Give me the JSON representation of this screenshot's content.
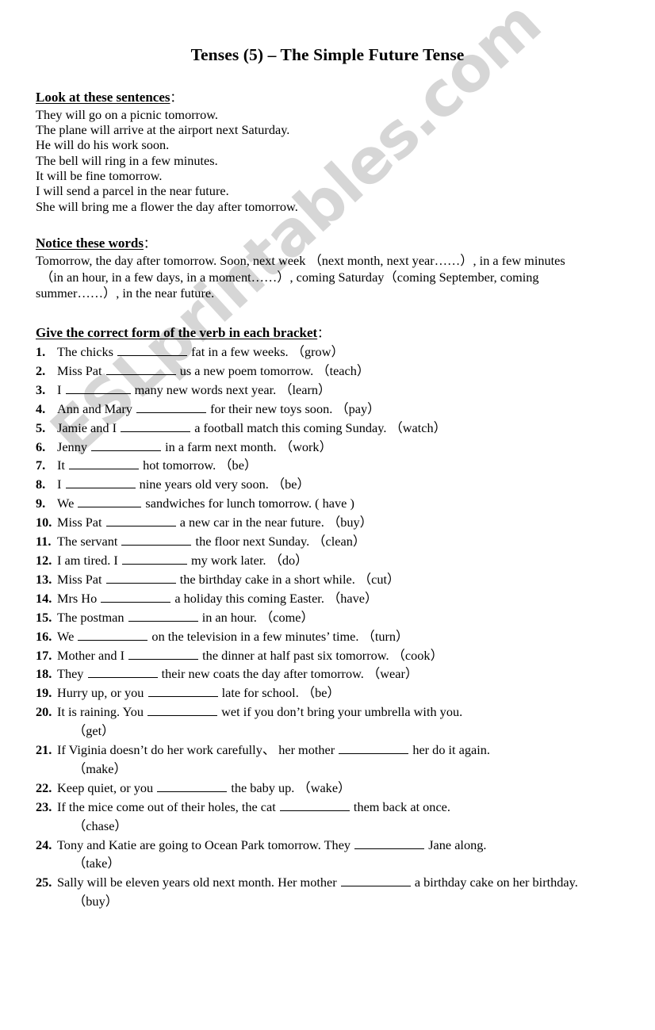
{
  "document": {
    "title": "Tenses (5) – The Simple Future Tense",
    "watermark": "ESLprintables.com",
    "watermark_color": "#d6d6d6",
    "text_color": "#000000",
    "background_color": "#ffffff"
  },
  "section_examples": {
    "heading": "Look at these sentences",
    "heading_colon": "：",
    "sentences": [
      "They will go on a picnic tomorrow.",
      "The plane will arrive at the airport next Saturday.",
      "He will do his work soon.",
      "The bell will ring in a few minutes.",
      "It will be fine tomorrow.",
      "I will send a parcel in the near future.",
      "She will bring me a flower the day after tomorrow."
    ]
  },
  "section_notice": {
    "heading": "Notice these words",
    "heading_colon": "：",
    "line1": "Tomorrow, the day after tomorrow. Soon, next week  （next month, next year……）, in a few minutes",
    "line2": "（in an hour, in a few days, in a moment……）, coming Saturday（coming September, coming",
    "line3": "summer……）, in the near future."
  },
  "section_exercise": {
    "heading": "Give the correct form of the verb in each bracket",
    "heading_colon": "：",
    "items": [
      {
        "number": "1.",
        "before": "The chicks ",
        "blank_width": 88,
        "after": " fat in a few weeks.  ",
        "hint": "（grow）",
        "hint_on_new_line": false,
        "verb": "grow"
      },
      {
        "number": "2.",
        "before": "Miss Pat ",
        "blank_width": 88,
        "after": " us a new poem tomorrow.  ",
        "hint": "（teach）",
        "hint_on_new_line": false,
        "verb": "teach"
      },
      {
        "number": "3.",
        "before": "I ",
        "blank_width": 82,
        "after": " many new words next year.  ",
        "hint": "（learn）",
        "hint_on_new_line": false,
        "verb": "learn"
      },
      {
        "number": "4.",
        "before": "Ann and Mary ",
        "blank_width": 88,
        "after": " for their new toys soon.  ",
        "hint": "（pay）",
        "hint_on_new_line": false,
        "verb": "pay"
      },
      {
        "number": "5.",
        "before": "Jamie and I ",
        "blank_width": 88,
        "after": " a football match this coming Sunday.  ",
        "hint": "（watch）",
        "hint_on_new_line": false,
        "verb": "watch"
      },
      {
        "number": "6.",
        "before": "Jenny ",
        "blank_width": 88,
        "after": " in a farm next month.  ",
        "hint": "（work）",
        "hint_on_new_line": false,
        "verb": "work"
      },
      {
        "number": "7.",
        "before": "It ",
        "blank_width": 88,
        "after": " hot tomorrow.  ",
        "hint": "（be）",
        "hint_on_new_line": false,
        "verb": "be"
      },
      {
        "number": "8.",
        "before": "I ",
        "blank_width": 88,
        "after": " nine years old very soon.  ",
        "hint": "（be）",
        "hint_on_new_line": false,
        "verb": "be"
      },
      {
        "number": "9.",
        "before": "We ",
        "blank_width": 80,
        "after": " sandwiches for lunch tomorrow. ",
        "hint": "( have )",
        "hint_on_new_line": false,
        "verb": "have"
      },
      {
        "number": "10.",
        "before": "Miss Pat ",
        "blank_width": 88,
        "after": " a new car in the near future.  ",
        "hint": "（buy）",
        "hint_on_new_line": false,
        "verb": "buy"
      },
      {
        "number": "11.",
        "before": "The servant ",
        "blank_width": 88,
        "after": " the floor next Sunday.  ",
        "hint": "（clean）",
        "hint_on_new_line": false,
        "verb": "clean"
      },
      {
        "number": "12.",
        "before": "I am tired. I ",
        "blank_width": 82,
        "after": " my work later.  ",
        "hint": "（do）",
        "hint_on_new_line": false,
        "verb": "do"
      },
      {
        "number": "13.",
        "before": "Miss Pat ",
        "blank_width": 88,
        "after": " the birthday cake in a short while.  ",
        "hint": "（cut）",
        "hint_on_new_line": false,
        "verb": "cut"
      },
      {
        "number": "14.",
        "before": "Mrs Ho ",
        "blank_width": 88,
        "after": " a holiday this coming Easter.  ",
        "hint": "（have）",
        "hint_on_new_line": false,
        "verb": "have"
      },
      {
        "number": "15.",
        "before": "The postman ",
        "blank_width": 88,
        "after": " in an hour.  ",
        "hint": "（come）",
        "hint_on_new_line": false,
        "verb": "come"
      },
      {
        "number": "16.",
        "before": "We ",
        "blank_width": 88,
        "after": " on the television in a few minutes’ time.  ",
        "hint": "（turn）",
        "hint_on_new_line": false,
        "verb": "turn"
      },
      {
        "number": "17.",
        "before": "Mother and I ",
        "blank_width": 88,
        "after": " the dinner at half past six tomorrow.  ",
        "hint": "（cook）",
        "hint_on_new_line": false,
        "verb": "cook"
      },
      {
        "number": "18.",
        "before": "They ",
        "blank_width": 88,
        "after": " their new coats the day after tomorrow.  ",
        "hint": "（wear）",
        "hint_on_new_line": false,
        "verb": "wear"
      },
      {
        "number": "19.",
        "before": "Hurry up, or you ",
        "blank_width": 88,
        "after": " late for school.  ",
        "hint": "（be）",
        "hint_on_new_line": false,
        "verb": "be"
      },
      {
        "number": "20.",
        "before": "It is raining. You ",
        "blank_width": 88,
        "after": " wet if you don’t bring your umbrella with you.",
        "hint": "（get）",
        "hint_on_new_line": true,
        "verb": "get"
      },
      {
        "number": "21.",
        "before": "If Viginia doesn’t do her work carefully、  her mother ",
        "blank_width": 88,
        "after": " her do it again.",
        "hint": "（make）",
        "hint_on_new_line": true,
        "verb": "make"
      },
      {
        "number": "22.",
        "before": "Keep quiet, or you ",
        "blank_width": 88,
        "after": " the baby up.  ",
        "hint": "（wake）",
        "hint_on_new_line": false,
        "verb": "wake"
      },
      {
        "number": "23.",
        "before": "If the mice come out of their holes, the cat ",
        "blank_width": 88,
        "after": " them back at once.",
        "hint": "（chase）",
        "hint_on_new_line": true,
        "verb": "chase"
      },
      {
        "number": "24.",
        "before": "Tony and Katie are going to Ocean Park tomorrow. They ",
        "blank_width": 88,
        "after": " Jane along.",
        "hint": "（take）",
        "hint_on_new_line": true,
        "verb": "take"
      },
      {
        "number": "25.",
        "before": "Sally will be eleven years old next month. Her mother ",
        "blank_width": 88,
        "after": " a birthday cake on her birthday.",
        "hint": "（buy）",
        "hint_on_new_line": true,
        "verb": "buy"
      }
    ]
  }
}
